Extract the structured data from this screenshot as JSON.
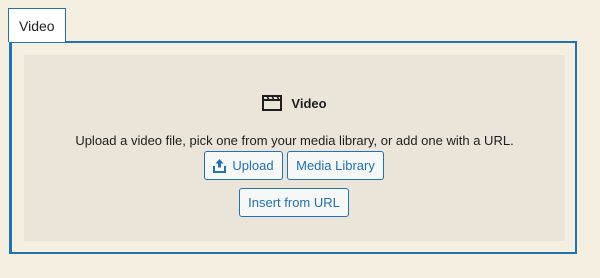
{
  "tab": {
    "label": "Video"
  },
  "placeholder": {
    "title": "Video",
    "title_icon": "video-clapperboard-icon",
    "instructions": "Upload a video file, pick one from your media library, or add one with a URL."
  },
  "buttons": {
    "upload_label": "Upload",
    "upload_icon": "upload-icon",
    "media_library_label": "Media Library",
    "insert_url_label": "Insert from URL"
  },
  "colors": {
    "accent": "#2271b1",
    "page_background": "#f5efe2",
    "placeholder_background": "#ebe5d9"
  }
}
